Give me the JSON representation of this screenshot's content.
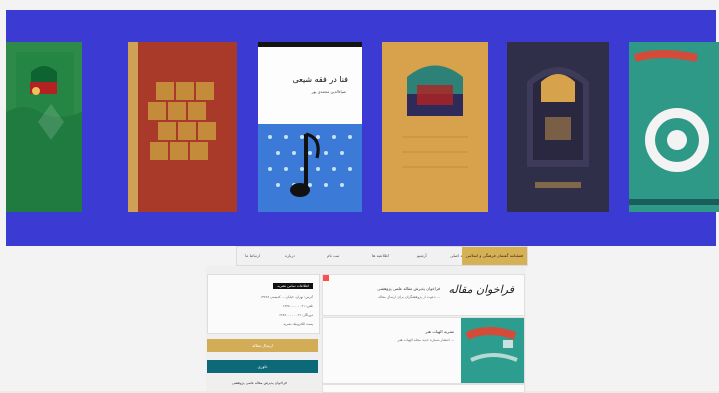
{
  "colors": {
    "banner": "#3b3bd3",
    "nav_active_bg": "#d6b055",
    "gold_button": "#d3ac57",
    "teal_button": "#0c6a78"
  },
  "banner": {
    "books": [
      {
        "name": "book-green"
      },
      {
        "name": "book-red"
      },
      {
        "name": "book-white",
        "title": "فنا در فقه شیعی",
        "subtitle": "ضیاء‌الدین محمدی پور"
      },
      {
        "name": "book-gold"
      },
      {
        "name": "book-navy"
      },
      {
        "name": "book-teal"
      }
    ]
  },
  "nav": {
    "items": [
      "ارتباط ما",
      "درباره",
      "ثبت نام",
      "اطلاعیه ها",
      "آرشیو",
      "صفحه اصلی"
    ],
    "active": "فصلنامه گفتمان فرهنگی و اسلامی"
  },
  "cards": [
    {
      "title": "فراخوان پذیرش مقاله علمی پژوهشی",
      "desc": "دعوت از پژوهشگران برای ارسال مقاله ..."
    },
    {
      "title": "نشریه الهیات هنر",
      "desc": "انتشار شماره جدید مجله الهیات هنر ..."
    }
  ],
  "side": {
    "header": "اطلاعات تماس نشریه",
    "lines": [
      "آدرس: تهران، خیابان ... کدپستی ۱۳۷۶۸",
      "تلفن: ۰۲۱ - ۶۶۴۸۰۰۰۰",
      "دورنگار: ۰۲۱ - ۶۶۴۸۰۰۰۰",
      "پست الکترونیک نشریه"
    ]
  },
  "buttons": {
    "gold": "ارسال مقاله",
    "teal": "داوری"
  },
  "footer": {
    "link": "فراخوان پذیرش مقاله علمی پژوهشی"
  },
  "logo_text": "فراخوان مقاله"
}
